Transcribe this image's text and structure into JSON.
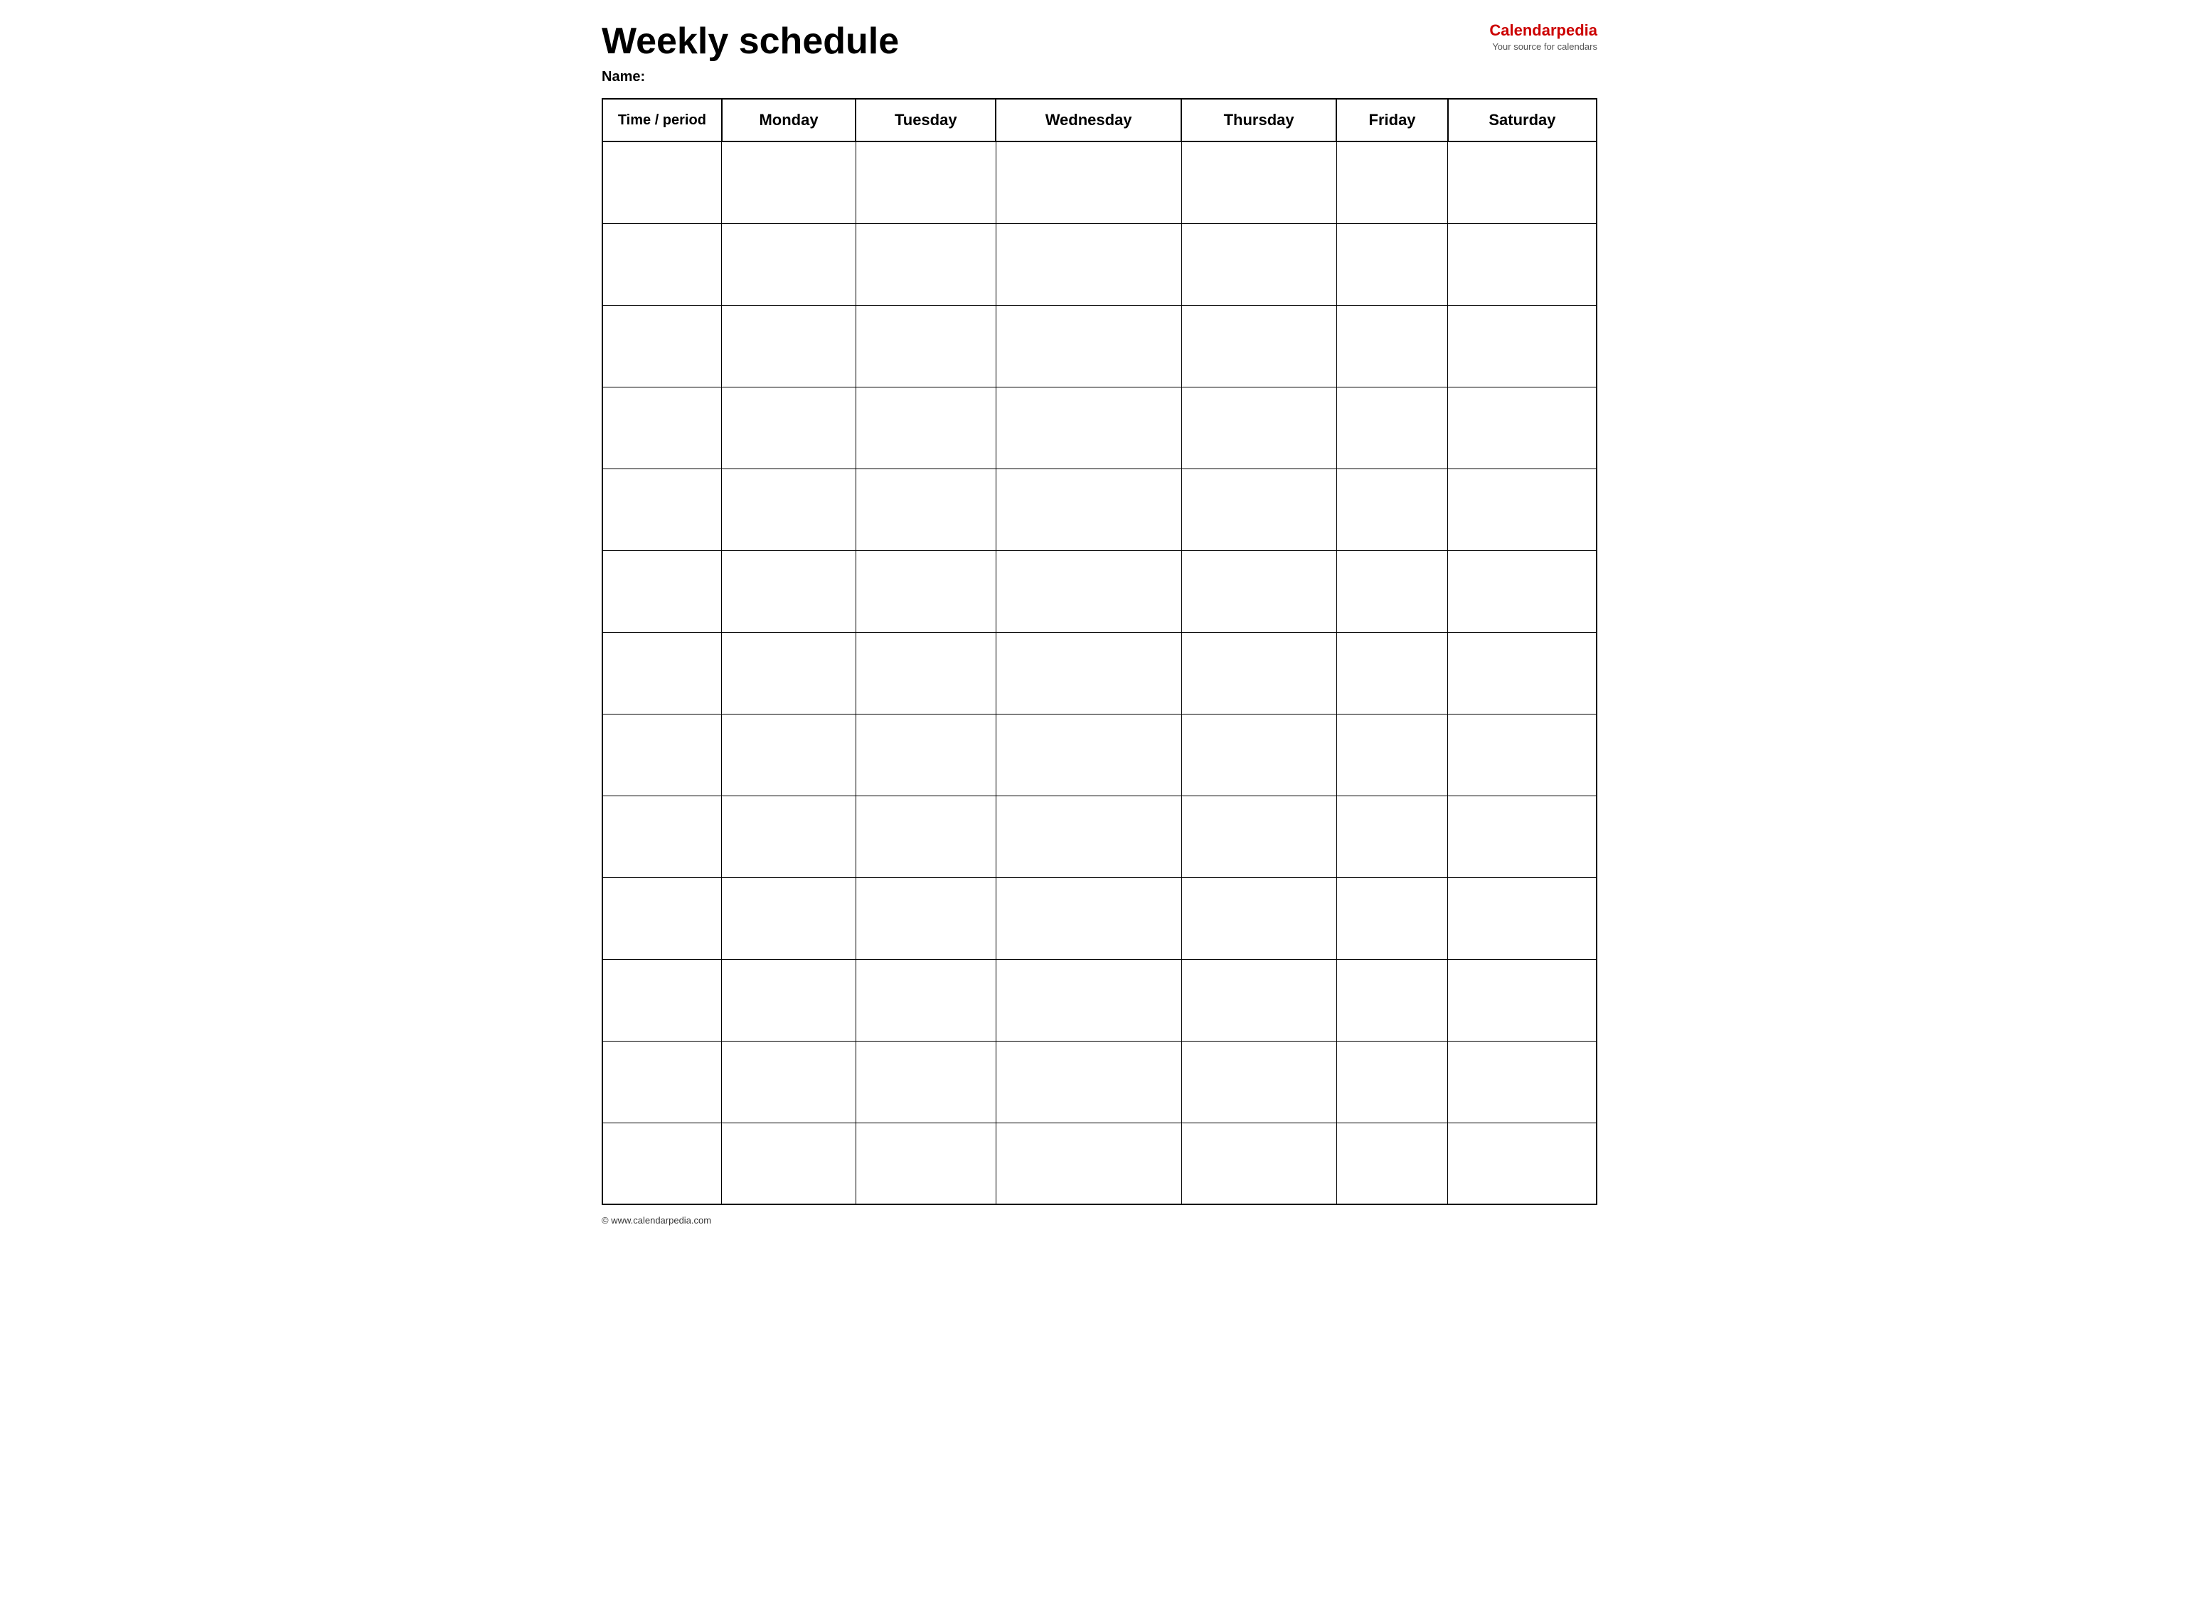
{
  "header": {
    "title": "Weekly schedule",
    "name_label": "Name:",
    "logo": {
      "brand_part1": "Calendar",
      "brand_part2": "pedia",
      "tagline": "Your source for calendars"
    }
  },
  "table": {
    "columns": [
      "Time / period",
      "Monday",
      "Tuesday",
      "Wednesday",
      "Thursday",
      "Friday",
      "Saturday"
    ],
    "rows": 13
  },
  "footer": {
    "copyright": "© www.calendarpedia.com"
  }
}
